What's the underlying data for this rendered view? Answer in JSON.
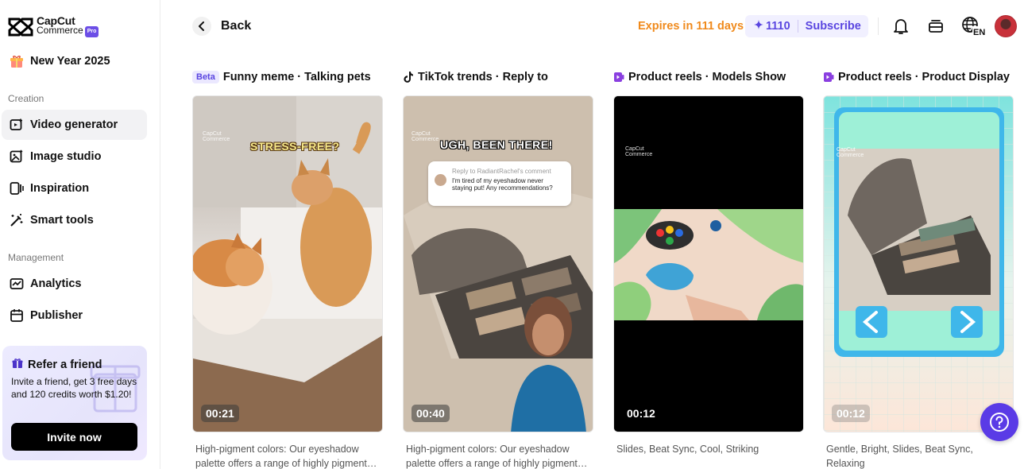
{
  "brand": {
    "name": "CapCut",
    "sub": "Commerce",
    "badge": "Pro"
  },
  "sidebar": {
    "promo": {
      "label": "New Year 2025"
    },
    "sections": [
      {
        "title": "Creation"
      },
      {
        "title": "Management"
      }
    ],
    "items": [
      {
        "label": "Video generator",
        "icon": "video-plus-icon",
        "active": true
      },
      {
        "label": "Image studio",
        "icon": "image-edit-icon"
      },
      {
        "label": "Inspiration",
        "icon": "inspiration-icon"
      },
      {
        "label": "Smart tools",
        "icon": "magic-wand-icon"
      },
      {
        "label": "Analytics",
        "icon": "chart-icon"
      },
      {
        "label": "Publisher",
        "icon": "calendar-icon"
      }
    ],
    "refer": {
      "title": "Refer a friend",
      "desc": "Invite a friend, get 3 free days and 120 credits worth $1.20!",
      "button": "Invite now"
    }
  },
  "topbar": {
    "back": "Back",
    "expires": "Expires in 111 days",
    "credits": "1110",
    "subscribe": "Subscribe",
    "icons": [
      "bell-icon",
      "inbox-icon",
      "language-icon"
    ],
    "language": "EN"
  },
  "cards": [
    {
      "badge": "Beta",
      "title": "Funny meme · Talking pets",
      "duration": "00:21",
      "caption": "STRESS-FREE?",
      "desc": "High-pigment colors: Our eyeshadow palette offers a range of highly pigment…"
    },
    {
      "icon": "tiktok-icon",
      "title": "TikTok trends · Reply to",
      "duration": "00:40",
      "caption": "UGH, BEEN THERE!",
      "reply_to": "Reply to RadiantRachel's comment",
      "comment": "I'm tired of my eyeshadow never staying put! Any recommendations?",
      "desc": "High-pigment colors: Our eyeshadow palette offers a range of highly pigment…"
    },
    {
      "icon": "product-reels-icon",
      "title": "Product reels · Models Show",
      "duration": "00:12",
      "desc": "Slides, Beat Sync, Cool, Striking"
    },
    {
      "icon": "product-reels-icon",
      "title": "Product reels · Product Display",
      "duration": "00:12",
      "desc": "Gentle, Bright, Slides, Beat Sync, Relaxing"
    }
  ],
  "watermark": {
    "line1": "CapCut",
    "line2": "Commerce"
  },
  "colors": {
    "accent": "#5a46e0",
    "expires": "#f08a1c",
    "help": "#5a3be6"
  }
}
